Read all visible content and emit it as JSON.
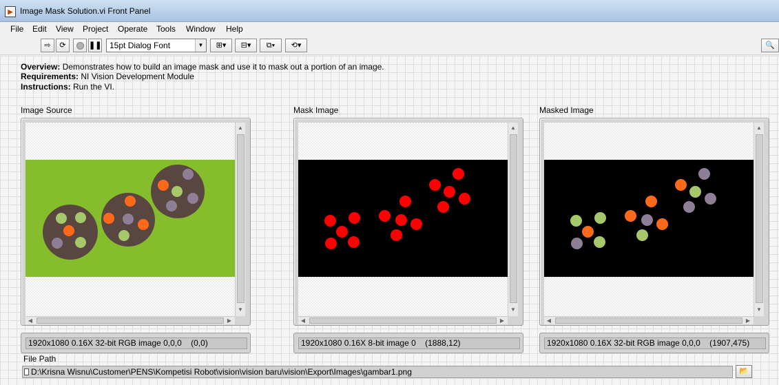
{
  "window": {
    "title": "Image Mask Solution.vi Front Panel"
  },
  "menu": [
    "File",
    "Edit",
    "View",
    "Project",
    "Operate",
    "Tools",
    "Window",
    "Help"
  ],
  "toolbar": {
    "font_label": "15pt Dialog Font",
    "icons": [
      "run-arrow-icon",
      "run-continuously-icon",
      "abort-icon",
      "pause-icon",
      "align-icon",
      "distribute-icon",
      "resize-icon",
      "reorder-icon",
      "search-icon"
    ]
  },
  "description": {
    "overview_label": "Overview:",
    "overview_text": "Demonstrates how to build an image mask and use it to mask out a portion of an image.",
    "requirements_label": "Requirements:",
    "requirements_text": "NI Vision Development Module",
    "instructions_label": "Instructions:",
    "instructions_text": "Run the VI."
  },
  "displays": [
    {
      "label": "Image Source",
      "status": "1920x1080 0.16X 32-bit RGB image 0,0,0    (0,0)"
    },
    {
      "label": "Mask Image",
      "status": "1920x1080 0.16X 8-bit image 0    (1888,12)"
    },
    {
      "label": "Masked Image",
      "status": "1920x1080 0.16X 32-bit RGB image 0,0,0    (1907,475)"
    }
  ],
  "file_path": {
    "label": "File Path",
    "value": "D:\\Krisna Wisnu\\Customer\\PENS\\Kompetisi Robot\\vision\\vision baru\\vision\\Export\\Images\\gambar1.png"
  },
  "colors": {
    "background_green": "#86bd2c",
    "plate_brown": "#5a4640",
    "mask_red": "#ff0000",
    "orange": "#ff6a1a",
    "green_dot": "#a6c86a",
    "purple_dot": "#8e7f97"
  }
}
